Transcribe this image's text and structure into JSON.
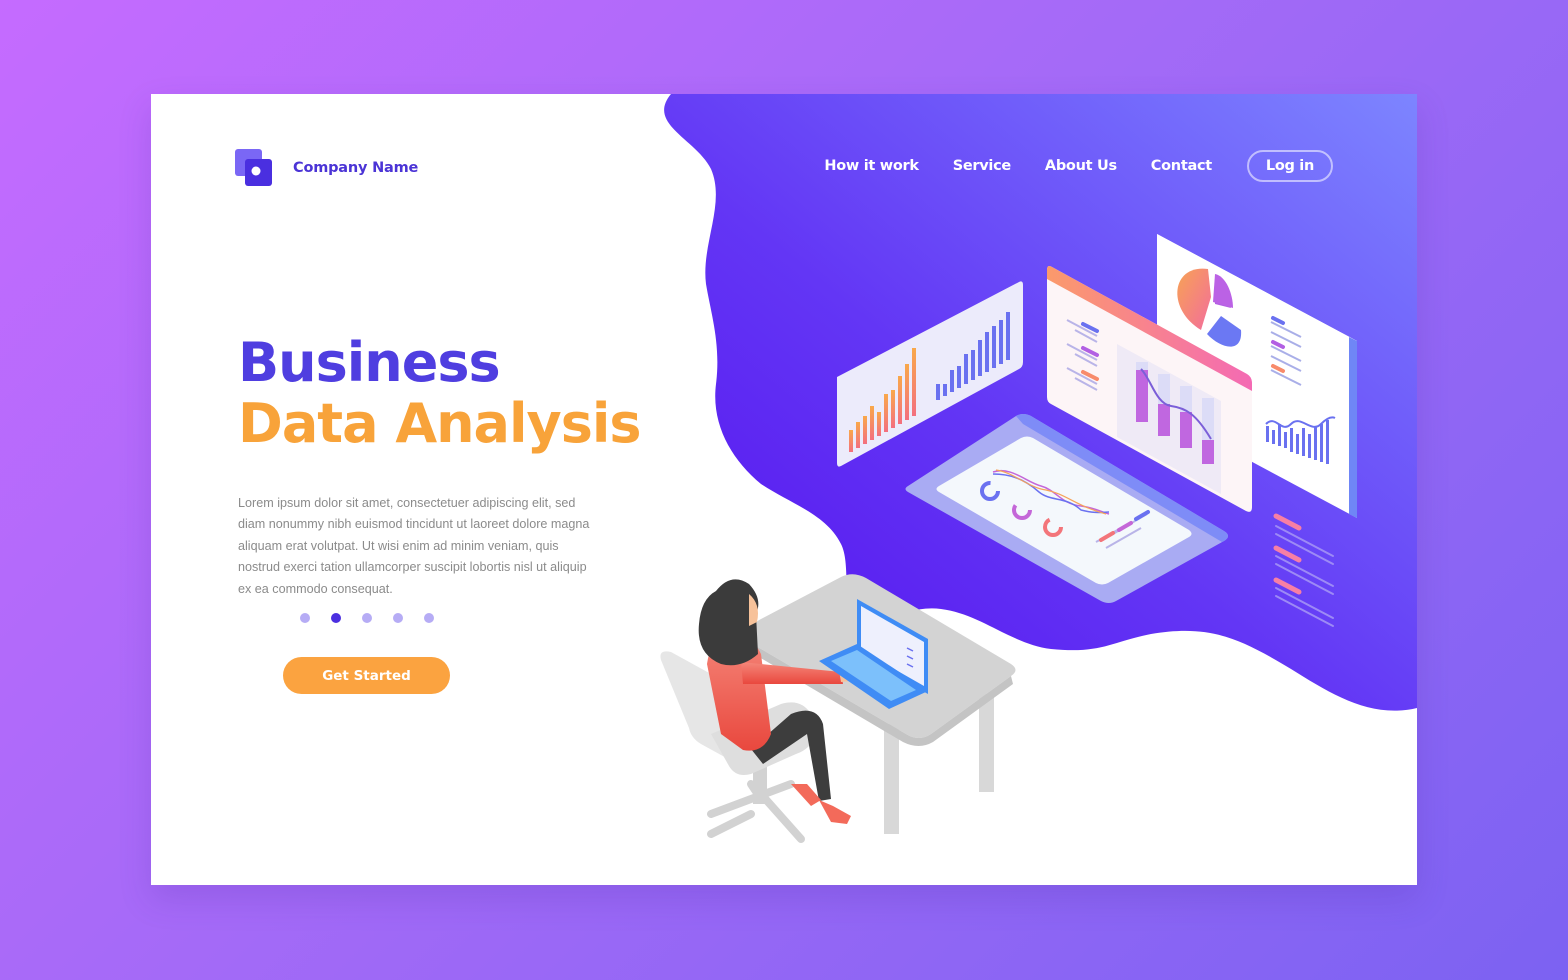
{
  "brand": {
    "name": "Company Name",
    "logo_icon": "overlapping-squares-logo"
  },
  "nav": {
    "items": [
      "How it work",
      "Service",
      "About Us",
      "Contact"
    ],
    "login_label": "Log in"
  },
  "hero": {
    "title_line1": "Business",
    "title_line2": "Data Analysis",
    "description": "Lorem ipsum dolor sit amet, consectetuer adipiscing elit, sed diam nonummy nibh euismod tincidunt ut laoreet dolore magna aliquam erat volutpat. Ut wisi enim ad minim veniam, quis nostrud exerci tation ullamcorper suscipit lobortis nisl ut aliquip ex ea commodo consequat.",
    "cta_label": "Get Started",
    "carousel": {
      "total": 5,
      "active_index": 1
    }
  },
  "colors": {
    "primary": "#4f3ee0",
    "accent": "#f8a33a",
    "background_start": "#c56bff",
    "background_end": "#7c62f2",
    "blob_top": "#7c7cff",
    "blob_bottom": "#5718f0"
  },
  "illustration": {
    "description": "Isometric woman at desk with laptop, floating dashboard panels",
    "panels": [
      "bar-chart-panel",
      "report-panel",
      "pie-chart-panel",
      "tablet-dashboard"
    ]
  }
}
